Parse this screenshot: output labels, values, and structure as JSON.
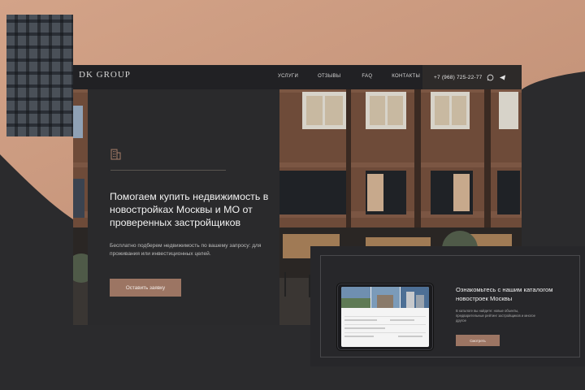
{
  "brand": {
    "name": "DK GROUP",
    "tagline": ""
  },
  "nav": {
    "items": [
      "УСЛУГИ",
      "ОТЗЫВЫ",
      "FAQ",
      "КОНТАКТЫ"
    ]
  },
  "header": {
    "phone": "+7 (968) 725-22-77",
    "messengers": [
      "whatsapp-icon",
      "telegram-icon"
    ]
  },
  "hero": {
    "title": "Помогаем купить недвижимость в новостройках Москвы и МО от проверенных застройщиков",
    "subtitle": "Бесплатно подберем недвижимость по вашему запросу: для проживания или инвестиционных целей.",
    "button": "Оставить заявку"
  },
  "catalog": {
    "title": "Ознакомьтесь с нашим каталогом новостроек Москвы",
    "text": "В каталоге вы найдете: новые объекты, предварительные рейтинг застройщиков и многое другое",
    "button": "Смотреть"
  },
  "colors": {
    "accent": "#9c7563",
    "background": "#2b2b2d",
    "peach": "#c9987f"
  }
}
